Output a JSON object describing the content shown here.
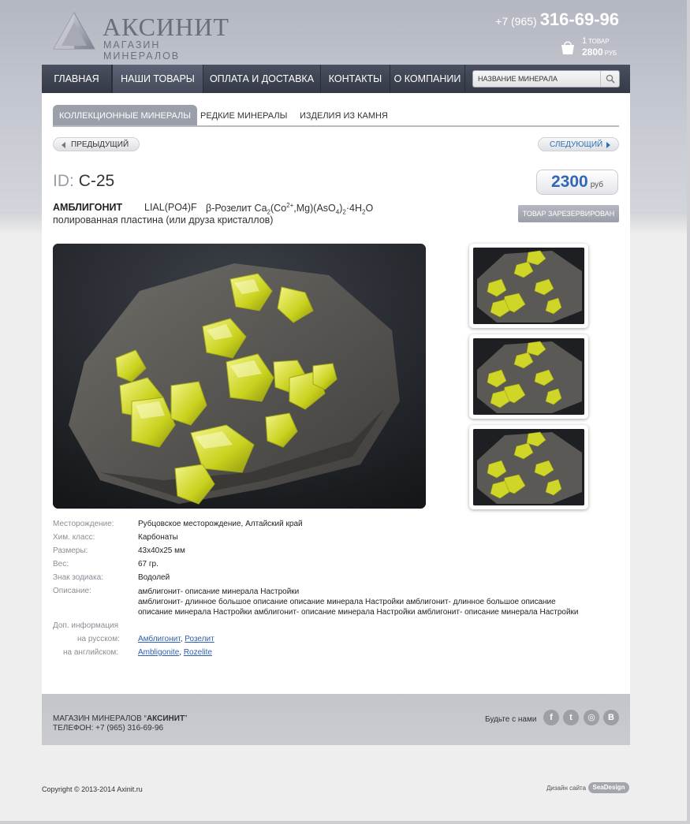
{
  "header": {
    "logo_title": "АКСИНИТ",
    "logo_subtitle": "МАГАЗИН МИНЕРАЛОВ",
    "phone_prefix": "+7 (965)",
    "phone_main": "316-69-96",
    "cart": {
      "count": "1",
      "count_unit": "товар",
      "sum": "2800",
      "sum_unit": "руб",
      "icon": "shopping-bag-icon"
    }
  },
  "nav": {
    "items": [
      {
        "label": "ГЛАВНАЯ"
      },
      {
        "label": "НАШИ ТОВАРЫ"
      },
      {
        "label": "ОПЛАТА И ДОСТАВКА"
      },
      {
        "label": "КОНТАКТЫ"
      },
      {
        "label": "О КОМПАНИИ"
      }
    ],
    "search_placeholder": "НАЗВАНИЕ МИНЕРАЛА",
    "search_icon": "search-icon"
  },
  "tabs": [
    {
      "label": "КОЛЛЕКЦИОННЫЕ МИНЕРАЛЫ"
    },
    {
      "label": "РЕДКИЕ МИНЕРАЛЫ"
    },
    {
      "label": "ИЗДЕЛИЯ ИЗ КАМНЯ"
    }
  ],
  "pager": {
    "prev": "ПРЕДЫДУЩИЙ",
    "next": "СЛЕДУЮЩИЙ"
  },
  "product": {
    "id_prefix": "ID:",
    "id": "С-25",
    "price": "2300",
    "currency": "руб",
    "reserved_label": "ТОВАР ЗАРЕЗЕРВИРОВАН",
    "name": "АМБЛИГОНИТ",
    "formula": "LIAL(PO4)F",
    "formula_b_prefix": "β-Розелит Ca",
    "formula_b_tail": "·4H",
    "description_short": "полированная пластина (или друза кристаллов)"
  },
  "props": {
    "deposit": {
      "label": "Месторождение:",
      "value": "Рубцовское месторождение, Алтайский край"
    },
    "chem_class": {
      "label": "Хим. класс:",
      "value": "Карбонаты"
    },
    "size": {
      "label": "Размеры:",
      "value": "43x40x25 мм"
    },
    "weight": {
      "label": "Вес:",
      "value": "67 гр."
    },
    "zodiac": {
      "label": "Знак зодиака:",
      "value": "Водолей"
    },
    "description": {
      "label": "Описание:",
      "lines": [
        "амблигонит- описание минерала Настройки",
        "амблигонит- длинное большое описание описание минерала Настройки амблигонит- длинное большое описание",
        "описание минерала Настройки амблигонит- описание минерала Настройки амблигонит- описание минерала Настройки"
      ]
    },
    "extra_info_label": "Доп. информация",
    "ru": {
      "label": "на русском:",
      "links": [
        "Амблигонит",
        "Розелит"
      ]
    },
    "en": {
      "label": "на английском:",
      "links": [
        "Ambligonite",
        "Rozelite"
      ]
    }
  },
  "footer": {
    "shop_prefix": "МАГАЗИН МИНЕРАЛОВ “",
    "shop_name": "АКСИНИТ",
    "shop_suffix": "”",
    "phone": "ТЕЛЕФОН: +7 (965) 316-69-96",
    "social_label": "Будьте с нами",
    "social": [
      {
        "name": "facebook-icon",
        "glyph": "f"
      },
      {
        "name": "twitter-icon",
        "glyph": "t"
      },
      {
        "name": "instagram-icon",
        "glyph": "◎"
      },
      {
        "name": "blog-icon",
        "glyph": "B"
      }
    ],
    "copyright": "Copyright © 2013-2014 Axinit.ru",
    "design_label": "Дизайн сайта",
    "design_badge": "SeaDesign"
  },
  "colors": {
    "accent_blue": "#3067b6",
    "nav_dark": "#3a3f4c",
    "crystal_yellow": "#d4dc2a"
  }
}
